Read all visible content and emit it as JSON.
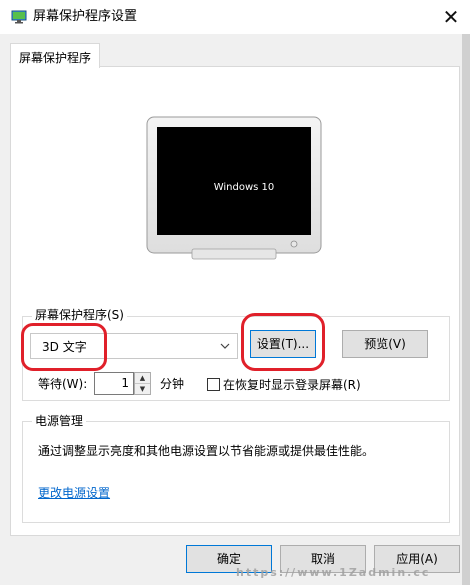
{
  "window": {
    "title": "屏幕保护程序设置",
    "close_glyph": "✕",
    "icon": "monitor-app-icon"
  },
  "tab": {
    "label": "屏幕保护程序"
  },
  "preview": {
    "screen_text": "Windows 10"
  },
  "screensaver": {
    "group_label": "屏幕保护程序(S)",
    "selected": "3D 文字",
    "settings_label": "设置(T)...",
    "preview_label": "预览(V)",
    "wait_label": "等待(W):",
    "wait_value": "1",
    "minutes_label": "分钟",
    "resume_label": "在恢复时显示登录屏幕(R)",
    "resume_checked": false
  },
  "power": {
    "group_label": "电源管理",
    "description": "通过调整显示亮度和其他电源设置以节省能源或提供最佳性能。",
    "link_label": "更改电源设置"
  },
  "footer": {
    "ok_label": "确定",
    "cancel_label": "取消",
    "apply_label": "应用(A)"
  },
  "watermark": "https://www.1Zadmin.cc",
  "colors": {
    "highlight": "#e0202a",
    "link": "#0066cc",
    "focus_border": "#0078d7"
  }
}
